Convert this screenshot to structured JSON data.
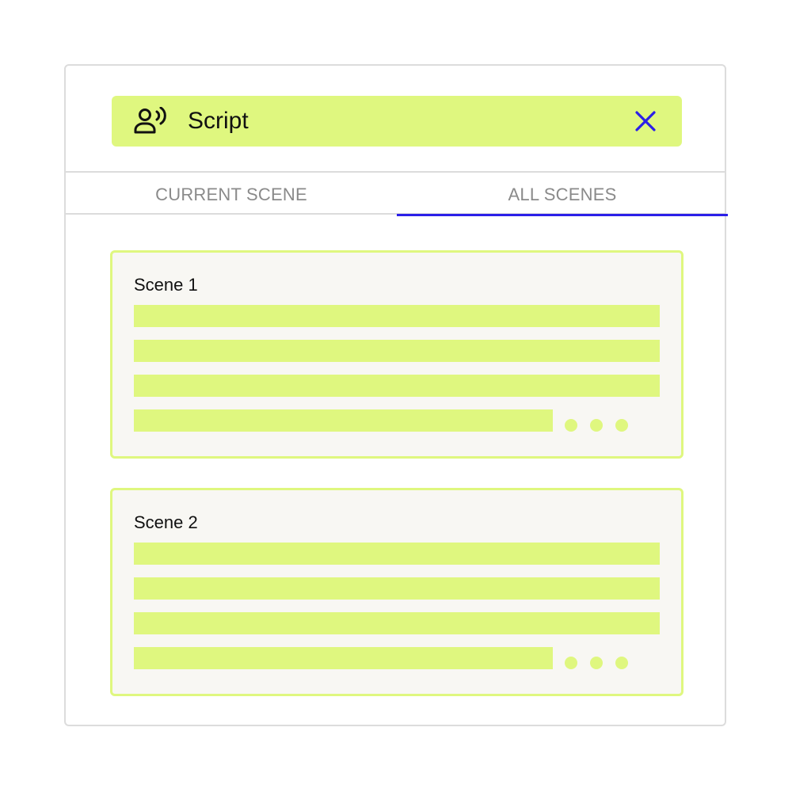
{
  "header": {
    "title": "Script",
    "icon": "person-speaking-icon",
    "close_icon": "close-icon"
  },
  "tabs": [
    {
      "label": "CURRENT SCENE",
      "active": false
    },
    {
      "label": "ALL SCENES",
      "active": true
    }
  ],
  "scenes": [
    {
      "title": "Scene 1",
      "more_icon": "ellipsis-icon"
    },
    {
      "title": "Scene 2",
      "more_icon": "ellipsis-icon"
    }
  ],
  "colors": {
    "accent_green": "#dff77f",
    "accent_blue": "#2b1fe8",
    "card_background": "#f8f7f3",
    "border_gray": "#dcdcdc",
    "tab_text_gray": "#8a8a8a"
  }
}
